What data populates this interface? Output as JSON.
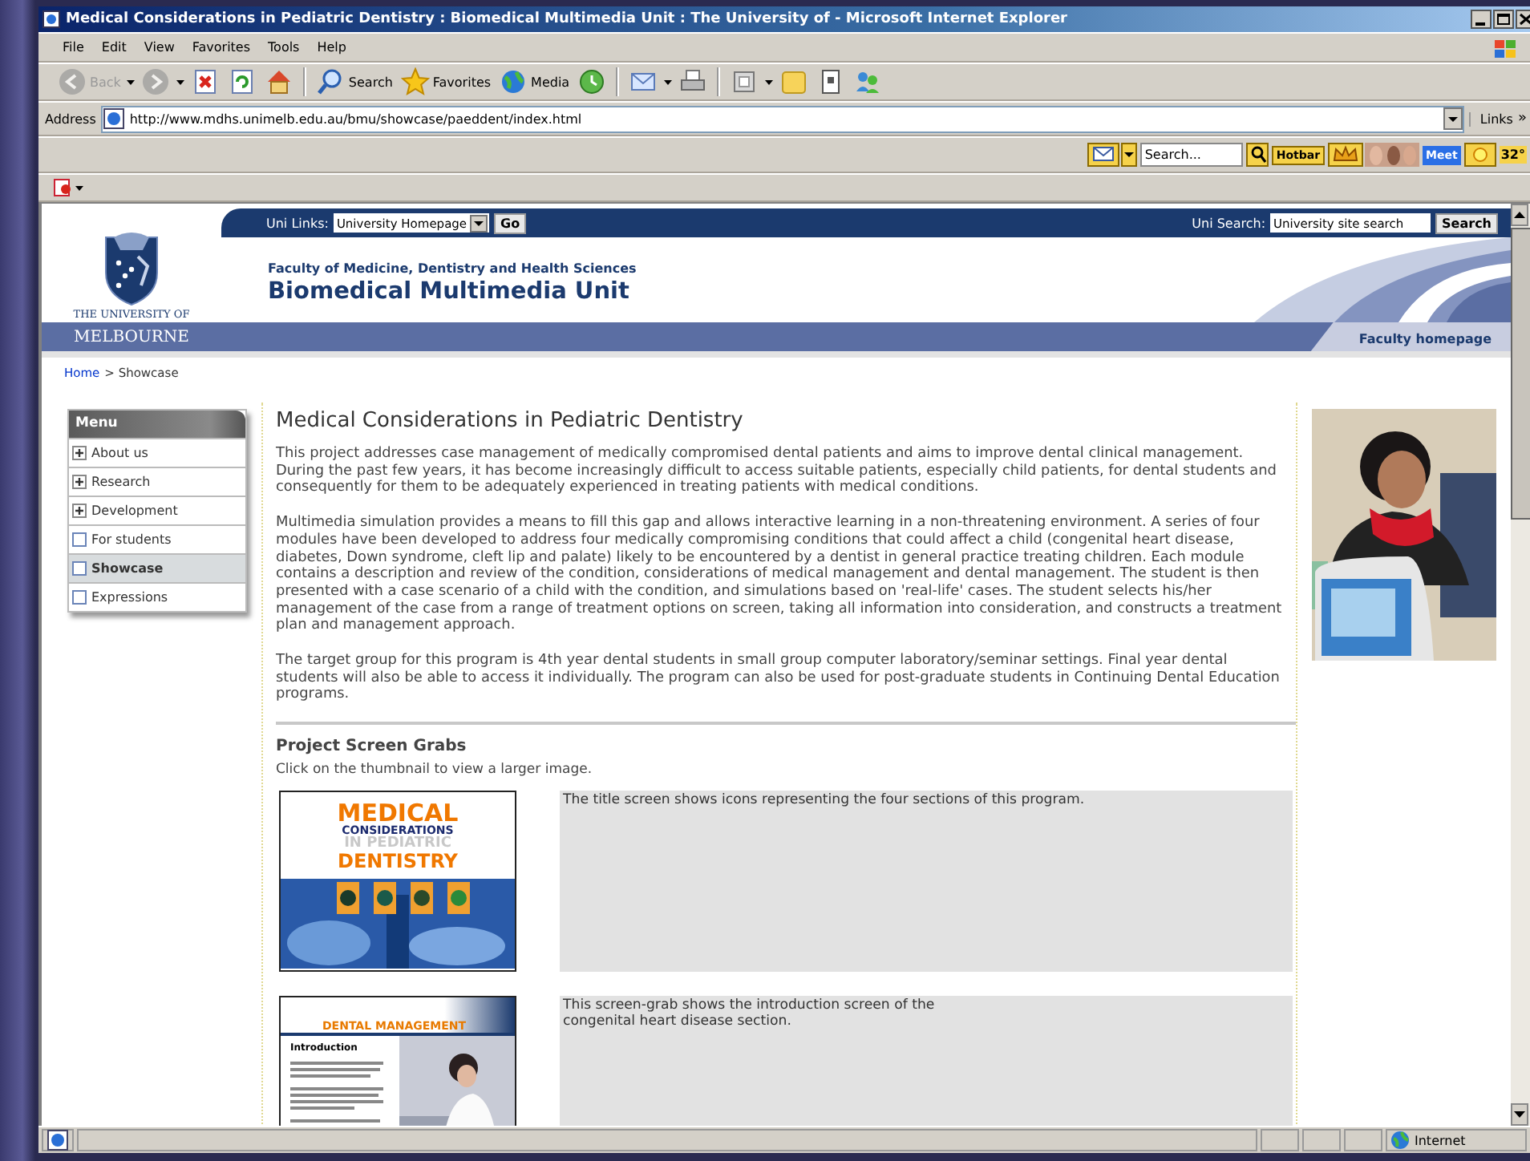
{
  "window": {
    "title": "Medical Considerations in Pediatric Dentistry : Biomedical Multimedia Unit : The University of  - Microsoft Internet Explorer"
  },
  "menu_bar": [
    "File",
    "Edit",
    "View",
    "Favorites",
    "Tools",
    "Help"
  ],
  "toolbar": [
    {
      "kind": "back",
      "label": "Back",
      "disabled": true,
      "dropdown": true
    },
    {
      "kind": "forward",
      "disabled": true,
      "dropdown": true
    },
    {
      "kind": "stop",
      "disabled": false,
      "dropdown": false
    },
    {
      "kind": "refresh",
      "disabled": false,
      "dropdown": false
    },
    {
      "kind": "home",
      "disabled": false,
      "dropdown": false
    },
    {
      "kind": "search",
      "label": "Search",
      "disabled": false,
      "dropdown": false
    },
    {
      "kind": "favorites",
      "label": "Favorites",
      "disabled": false,
      "dropdown": false
    },
    {
      "kind": "media",
      "label": "Media",
      "disabled": false,
      "dropdown": false
    },
    {
      "kind": "history",
      "disabled": false,
      "dropdown": false
    },
    {
      "kind": "mail",
      "disabled": false,
      "dropdown": true
    },
    {
      "kind": "print",
      "disabled": false,
      "dropdown": false
    },
    {
      "kind": "edit",
      "disabled": false,
      "dropdown": true
    },
    {
      "kind": "folder",
      "disabled": false,
      "dropdown": false
    },
    {
      "kind": "note",
      "disabled": false,
      "dropdown": false
    },
    {
      "kind": "messenger",
      "disabled": false,
      "dropdown": false
    }
  ],
  "address_bar": {
    "label": "Address",
    "value": "http://www.mdhs.unimelb.edu.au/bmu/showcase/paeddent/index.html",
    "links": "Links",
    "more": "»"
  },
  "search_toolbar": {
    "placeholder": "Search...",
    "hotbar": "Hotbar",
    "meet": "Meet",
    "temperature": "32°"
  },
  "site_header": {
    "uni_links_label": "Uni Links:",
    "uni_links_value": "University Homepage",
    "go_button": "Go",
    "uni_search_label": "Uni Search:",
    "uni_search_placeholder": "University site search",
    "search_button": "Search",
    "logo_top": "THE UNIVERSITY OF",
    "logo_bottom": "MELBOURNE",
    "faculty": "Faculty of Medicine, Dentistry and Health Sciences",
    "unit": "Biomedical Multimedia Unit",
    "faculty_homepage": "Faculty homepage"
  },
  "breadcrumb": {
    "home": "Home",
    "current": "> Showcase"
  },
  "menu": {
    "title": "Menu",
    "items": [
      {
        "label": "About us",
        "expandable": true,
        "selected": false
      },
      {
        "label": "Research",
        "expandable": true,
        "selected": false
      },
      {
        "label": "Development",
        "expandable": true,
        "selected": false
      },
      {
        "label": "For students",
        "expandable": false,
        "selected": false
      },
      {
        "label": "Showcase",
        "expandable": false,
        "selected": true
      },
      {
        "label": "Expressions",
        "expandable": false,
        "selected": false
      }
    ]
  },
  "content": {
    "heading": "Medical Considerations in Pediatric Dentistry",
    "paragraphs": [
      "This project addresses case management of medically compromised dental patients and aims to improve dental clinical management. During the past few years, it has become increasingly difficult to access suitable patients, especially child patients, for dental students and consequently for them to be adequately experienced in treating patients with medical conditions.",
      "Multimedia simulation provides a means to fill this gap and allows interactive learning in a non-threatening environment. A series of four modules have been developed to address four medically compromising conditions that could affect a child (congenital heart disease, diabetes, Down syndrome, cleft lip and palate) likely to be encountered by a dentist in general practice treating children. Each module contains a description and review of the condition, considerations of medical management and dental management. The student is then presented with a case scenario of a child with the condition, and simulations based on 'real-life' cases. The student selects his/her management of the case from a range of treatment options on screen, taking all information into consideration, and constructs a treatment plan and management approach.",
      "The target group for this program is 4th year dental students in small group computer laboratory/seminar settings. Final year dental students will also be able to access it individually. The program can also be used for post-graduate students in Continuing Dental Education programs."
    ],
    "section_heading": "Project Screen Grabs",
    "section_hint": "Click on the thumbnail to view a larger image.",
    "screen_grabs": [
      {
        "kind": "title_screen",
        "lines": [
          "MEDICAL",
          "CONSIDERATIONS",
          "IN PEDIATRIC",
          "DENTISTRY"
        ],
        "caption": "The title screen shows icons representing the four sections of this program."
      },
      {
        "kind": "intro_screen",
        "lines": [
          "DENTAL MANAGEMENT",
          "Introduction"
        ],
        "caption": "This screen-grab shows the introduction screen of the\ncongenital heart disease section."
      }
    ]
  },
  "status_bar": {
    "zone": "Internet"
  }
}
